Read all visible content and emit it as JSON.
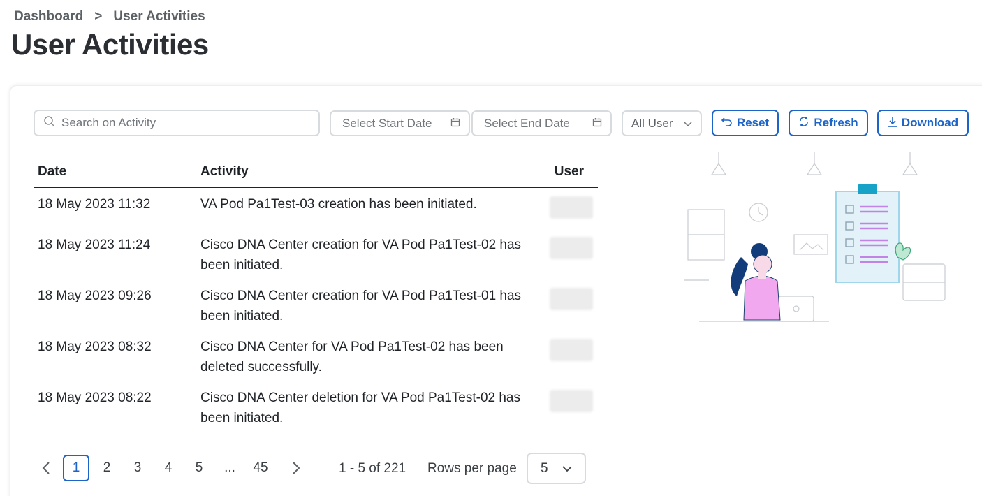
{
  "breadcrumb": {
    "home": "Dashboard",
    "separator": ">",
    "current": "User Activities"
  },
  "page": {
    "title": "User Activities"
  },
  "toolbar": {
    "search_placeholder": "Search on Activity",
    "start_date_placeholder": "Select Start Date",
    "end_date_placeholder": "Select End Date",
    "user_filter": "All User",
    "reset_label": "Reset",
    "refresh_label": "Refresh",
    "download_label": "Download"
  },
  "table": {
    "headers": {
      "date": "Date",
      "activity": "Activity",
      "user": "User"
    },
    "rows": [
      {
        "date": "18 May 2023 11:32",
        "activity": "VA Pod Pa1Test-03 creation has been initiated."
      },
      {
        "date": "18 May 2023 11:24",
        "activity": "Cisco DNA Center creation for VA Pod Pa1Test-02 has been initiated."
      },
      {
        "date": "18 May 2023 09:26",
        "activity": "Cisco DNA Center creation for VA Pod Pa1Test-01 has been initiated."
      },
      {
        "date": "18 May 2023 08:32",
        "activity": "Cisco DNA Center for VA Pod Pa1Test-02 has been deleted successfully."
      },
      {
        "date": "18 May 2023 08:22",
        "activity": "Cisco DNA Center deletion for VA Pod Pa1Test-02 has been initiated."
      }
    ]
  },
  "pagination": {
    "pages": [
      "1",
      "2",
      "3",
      "4",
      "5",
      "...",
      "45"
    ],
    "current_page": "1",
    "range_text": "1 - 5 of 221",
    "rows_per_page_label": "Rows per page",
    "rows_per_page_value": "5"
  },
  "colors": {
    "accent": "#1d64c8",
    "border": "#d8dbde",
    "text": "#1f2328"
  },
  "icons": [
    "search-icon",
    "calendar-icon",
    "chevron-down-icon",
    "reset-icon",
    "refresh-icon",
    "download-icon",
    "chevron-left-icon",
    "chevron-right-icon"
  ]
}
